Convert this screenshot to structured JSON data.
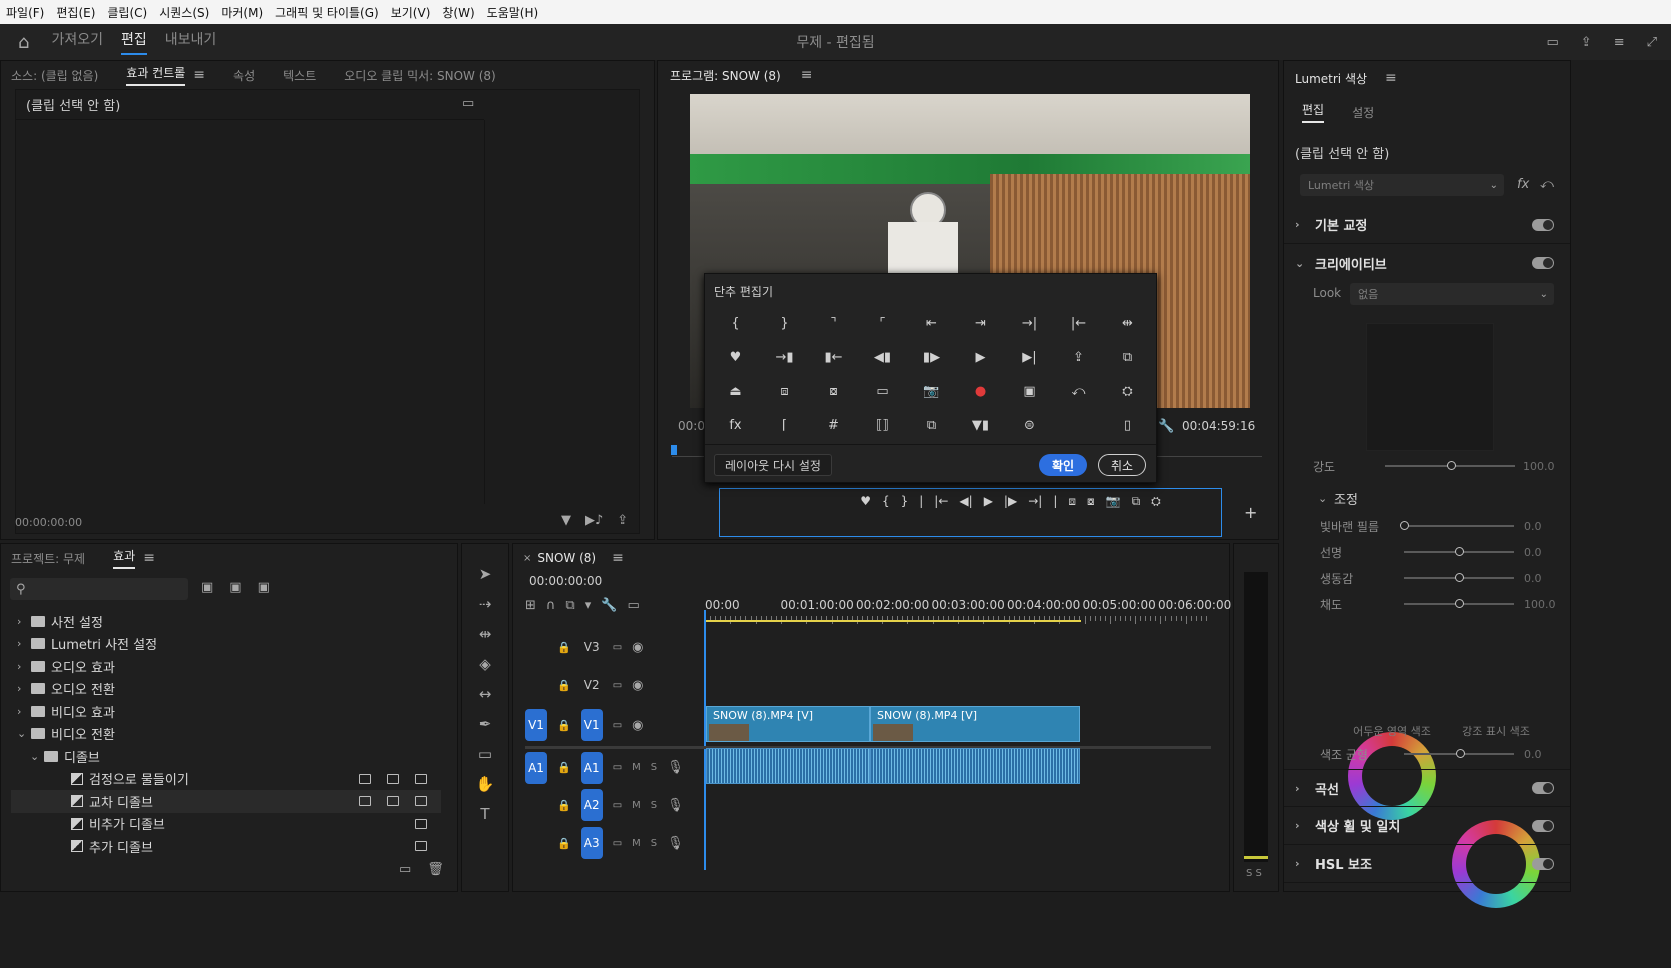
{
  "menu": [
    "파일(F)",
    "편집(E)",
    "클립(C)",
    "시퀀스(S)",
    "마커(M)",
    "그래픽 및 타이틀(G)",
    "보기(V)",
    "창(W)",
    "도움말(H)"
  ],
  "header": {
    "workspaces": [
      "가져오기",
      "편집",
      "내보내기"
    ],
    "active_workspace": "편집",
    "title": "무제 - 편집됨"
  },
  "source_panel": {
    "tabs": [
      "소스: (클립 없음)",
      "효과 컨트롤",
      "속성",
      "텍스트",
      "오디오 클립 믹서: SNOW (8)"
    ],
    "active_tab": "효과 컨트롤",
    "no_clip": "(클립 선택 안 함)",
    "timecode": "00:00:00:00"
  },
  "program_monitor": {
    "title": "프로그램: SNOW (8)",
    "timecode_left": "00:0",
    "timecode_right": "00:04:59:16"
  },
  "button_editor": {
    "title": "단추 편집기",
    "reset_label": "레이아웃 다시 설정",
    "ok_label": "확인",
    "cancel_label": "취소",
    "buttons": [
      "{",
      "}",
      "⌝",
      "⌜",
      "⇤",
      "⇥",
      "→|",
      "|←",
      "⇹",
      "♥",
      "→▮",
      "▮←",
      "◀▮",
      "▮▶",
      "▶",
      "▶|",
      "⇪",
      "⧉",
      "⏏",
      "⧈",
      "⧇",
      "▭",
      "📷",
      "●",
      "▣",
      "⤺",
      "⛭",
      "fx",
      "⌈",
      "#",
      "⟦⟧",
      "⧉",
      "▼▮",
      "⊜",
      "▯"
    ],
    "bar_buttons": [
      "♥",
      "{",
      "}",
      "|",
      "|←",
      "◀|",
      "▶",
      "|▶",
      "→|",
      "|",
      "⧈",
      "⧇",
      "📷",
      "⧉",
      "⛭"
    ]
  },
  "lumetri": {
    "title": "Lumetri 색상",
    "tabs": [
      "편집",
      "설정"
    ],
    "active_tab": "편집",
    "no_clip": "(클립 선택 안 함)",
    "dropdown": "Lumetri 색상",
    "sections": {
      "basic": "기본 교정",
      "creative": "크리에이티브",
      "curves": "곡선",
      "wheels": "색상 휠 및 일치",
      "hsl": "HSL 보조"
    },
    "look_label": "Look",
    "look_value": "없음",
    "intensity_label": "강도",
    "intensity_value": "100.0",
    "adjust_label": "조정",
    "sliders": [
      {
        "label": "빛바랜 필름",
        "value": "0.0",
        "pos": 0.0
      },
      {
        "label": "선명",
        "value": "0.0",
        "pos": 0.5
      },
      {
        "label": "생동감",
        "value": "0.0",
        "pos": 0.5
      },
      {
        "label": "채도",
        "value": "100.0",
        "pos": 0.5
      }
    ],
    "wheel_labels": [
      "어두운 영역 색조",
      "강조 표시 색조"
    ],
    "balance_label": "색조 균형",
    "balance_value": "0.0"
  },
  "project_panel": {
    "tabs": [
      "프로젝트: 무제",
      "효과"
    ],
    "active_tab": "효과",
    "tree": [
      {
        "label": "사전 설정",
        "indent": 0,
        "type": "folder",
        "open": false
      },
      {
        "label": "Lumetri 사전 설정",
        "indent": 0,
        "type": "folder",
        "open": false
      },
      {
        "label": "오디오 효과",
        "indent": 0,
        "type": "folder",
        "open": false
      },
      {
        "label": "오디오 전환",
        "indent": 0,
        "type": "folder",
        "open": false
      },
      {
        "label": "비디오 효과",
        "indent": 0,
        "type": "folder",
        "open": false
      },
      {
        "label": "비디오 전환",
        "indent": 0,
        "type": "folder",
        "open": true
      },
      {
        "label": "디졸브",
        "indent": 1,
        "type": "folder",
        "open": true
      },
      {
        "label": "검정으로 물들이기",
        "indent": 2,
        "type": "item"
      },
      {
        "label": "교차 디졸브",
        "indent": 2,
        "type": "item",
        "selected": true
      },
      {
        "label": "비추가 디졸브",
        "indent": 2,
        "type": "item"
      },
      {
        "label": "추가 디졸브",
        "indent": 2,
        "type": "item"
      }
    ]
  },
  "timeline": {
    "tab": "SNOW (8)",
    "timecode": "00:00:00:00",
    "ruler": [
      "00:00",
      "00:01:00:00",
      "00:02:00:00",
      "00:03:00:00",
      "00:04:00:00",
      "00:05:00:00",
      "00:06:00:00",
      "0"
    ],
    "video_tracks": [
      "V3",
      "V2",
      "V1"
    ],
    "audio_tracks": [
      "A1",
      "A2",
      "A3"
    ],
    "source_patch_v": "V1",
    "source_patch_a": "A1",
    "clips": [
      "SNOW (8).MP4 [V]",
      "SNOW (8).MP4 [V]"
    ],
    "mute": "M",
    "solo": "S",
    "meter_label": "S S"
  }
}
